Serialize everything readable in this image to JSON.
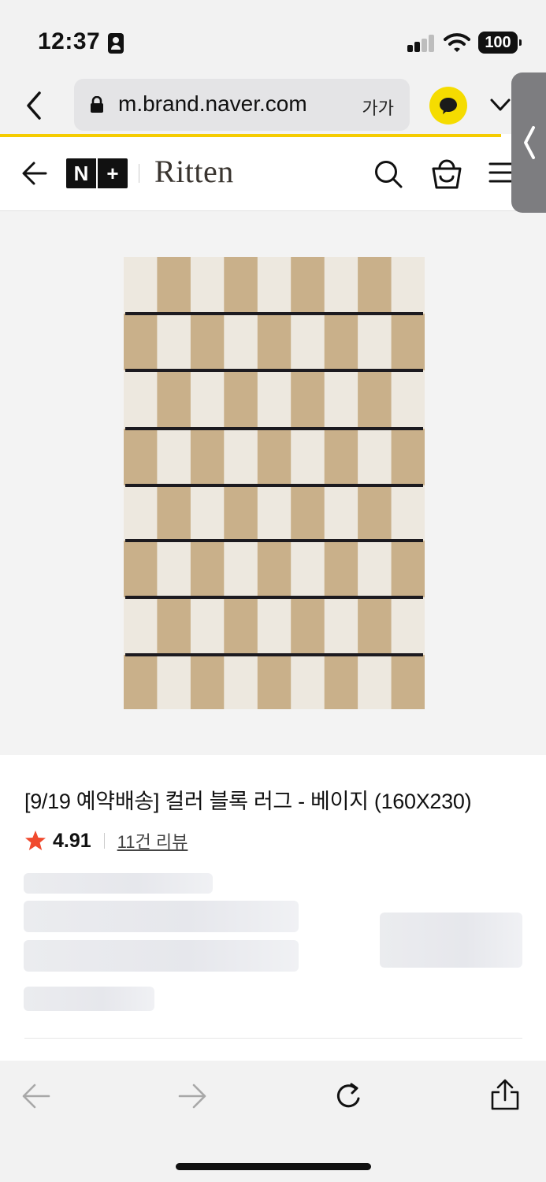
{
  "status_bar": {
    "time": "12:37",
    "battery": "100",
    "icons": [
      "id-card-icon",
      "signal-icon",
      "wifi-icon",
      "battery-icon"
    ]
  },
  "browser": {
    "url": "m.brand.naver.com",
    "text_size_label": "가가",
    "icons": [
      "back-chevron-icon",
      "lock-icon",
      "kakao-talk-icon",
      "chevron-down-icon",
      "side-panel-chevron-icon"
    ],
    "accent_color": "#f5cc00"
  },
  "site_header": {
    "logo": {
      "left": "N",
      "right": "+"
    },
    "brand": "Ritten",
    "icons": [
      "back-arrow-icon",
      "search-icon",
      "cart-icon",
      "menu-icon"
    ]
  },
  "product": {
    "title": "[9/19 예약배송] 컬러 블록 러그 - 베이지 (160X230)",
    "rating": "4.91",
    "review_label": "11건 리뷰",
    "star_color": "#f04a2e",
    "rug_colors": {
      "beige": "#c9b08a",
      "cream": "#ede8df",
      "line": "#1c1a1f"
    }
  },
  "toolbar": {
    "icons": [
      "back-arrow-icon",
      "forward-arrow-icon",
      "reload-icon",
      "share-icon"
    ]
  }
}
